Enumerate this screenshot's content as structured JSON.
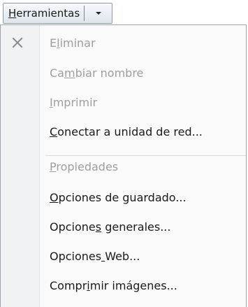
{
  "toolbar": {
    "tools_button": {
      "label": "Herramientas",
      "mnemonic_index": 0,
      "arrow_icon": "chevron-down-icon"
    }
  },
  "menu": {
    "items": [
      {
        "label": "Eliminar",
        "mnemonic_index": 1,
        "enabled": false,
        "icon": "delete-x-icon"
      },
      {
        "label": "Cambiar nombre",
        "mnemonic_index": 2,
        "enabled": false
      },
      {
        "label": "Imprimir",
        "mnemonic_index": 0,
        "enabled": false
      },
      {
        "label": "Conectar a unidad de red...",
        "mnemonic_index": 0,
        "enabled": true
      },
      {
        "separator": true
      },
      {
        "label": "Propiedades",
        "mnemonic_index": 0,
        "enabled": false
      },
      {
        "label": "Opciones de guardado...",
        "mnemonic_index": 0,
        "enabled": true
      },
      {
        "label": "Opciones generales...",
        "mnemonic_index": 7,
        "enabled": true
      },
      {
        "label": "Opciones Web...",
        "mnemonic_index": 8,
        "enabled": true
      },
      {
        "label": "Comprimir imágenes...",
        "mnemonic_index": 5,
        "enabled": true
      }
    ]
  },
  "colors": {
    "disabled_text": "#9e9e9e",
    "enabled_text": "#1a1a1a",
    "gutter": "#f1f2f4",
    "icon_disabled": "#8a8a8a"
  }
}
